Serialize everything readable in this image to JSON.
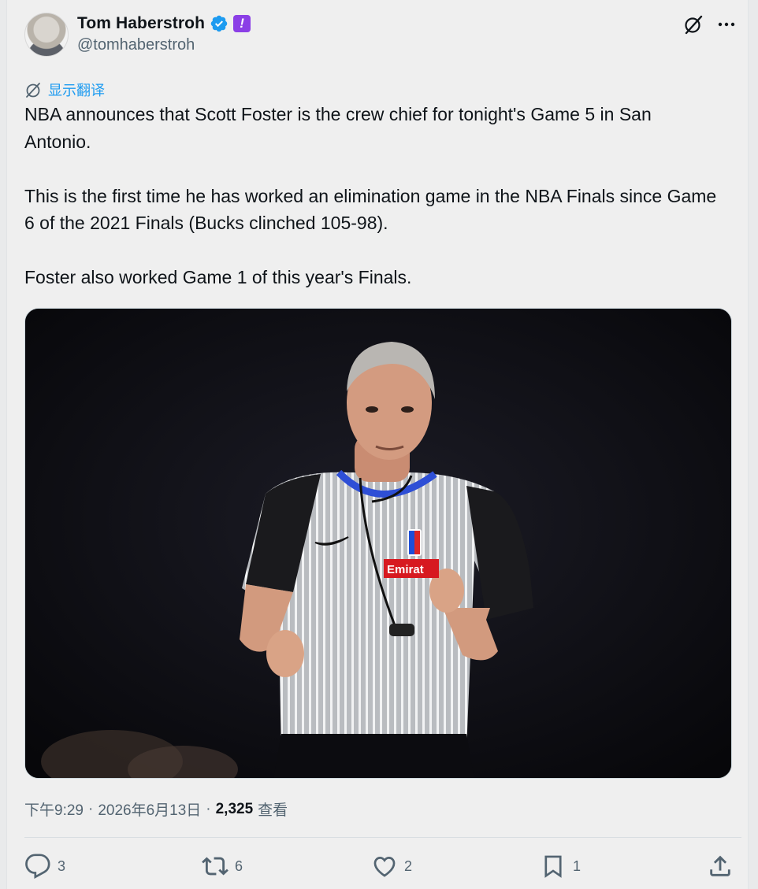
{
  "author": {
    "name": "Tom Haberstroh",
    "handle": "@tomhaberstroh",
    "avatar_icon": "avatar",
    "verified_icon": "verified-badge-icon",
    "affiliate_badge_icon": "purple-exclamation-badge-icon"
  },
  "header_actions": {
    "grok_icon": "grok-slash-icon",
    "more_icon": "more-dots-icon"
  },
  "translate": {
    "label": "显示翻译",
    "icon": "translate-globe-icon"
  },
  "tweet": {
    "paragraphs": [
      "NBA announces that Scott Foster is the crew chief for tonight's Game 5 in San Antonio.",
      "This is the first time he has worked an elimination game in the NBA Finals since Game 6 of the 2021 Finals (Bucks clinched 105-98).",
      "Foster also worked Game 1 of this year's Finals."
    ],
    "media_patch_text": "Emirat"
  },
  "meta": {
    "time": "下午9:29",
    "sep1": "·",
    "date": "2026年6月13日",
    "sep2": "·",
    "views": "2,325",
    "views_label": "查看"
  },
  "actions": {
    "replies": "3",
    "reposts": "6",
    "likes": "2",
    "bookmarks": "1"
  },
  "colors": {
    "accent": "#1d9bf0",
    "badge_purple": "#8b3fe6",
    "secondary_text": "#536471"
  }
}
